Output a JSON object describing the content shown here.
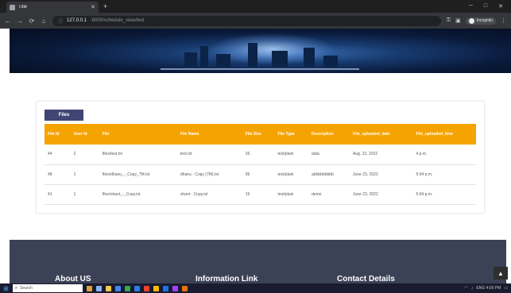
{
  "browser": {
    "tab_title": "Title",
    "address_host": "127.0.0.1",
    "address_path": ":8000/schedule_view/text",
    "incognito_label": "Incognito"
  },
  "files": {
    "button_label": "Files",
    "columns": [
      "File Id",
      "User Id",
      "File",
      "File Name",
      "File Size",
      "File Type",
      "Description",
      "File_uploaded_date",
      "File_uploaded_time"
    ],
    "rows": [
      [
        "44",
        "2",
        "files/test.txt",
        "test.txt",
        "26",
        "text/plain",
        "data",
        "Aug. 22, 2022",
        "4 p.m."
      ],
      [
        "48",
        "1",
        "files/dhanu_-_Copy_7M.txt",
        "dhanu - Copy (7M).txt",
        "99",
        "text/plain",
        "abbbbbbbbb",
        "June 23, 2022",
        "5:04 p.m."
      ],
      [
        "41",
        "1",
        "files/shant_-_Copy.txt",
        "shant - Copy.txt",
        "19",
        "text/plain",
        "demo",
        "June 23, 2022",
        "5:04 p.m."
      ]
    ]
  },
  "footer": {
    "about": "About US",
    "info": "Information Link",
    "contact": "Contact Details"
  },
  "taskbar": {
    "search_text": "Search",
    "tray_text": "ENG 4:00 PM"
  }
}
